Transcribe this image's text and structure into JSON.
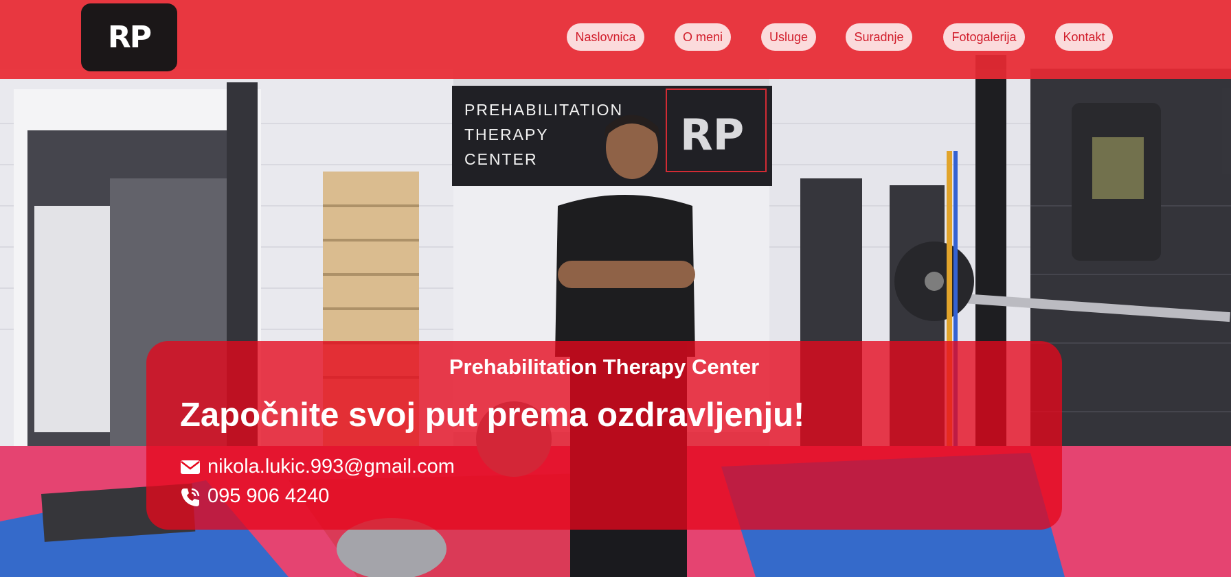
{
  "brand": {
    "logo_text": "RP"
  },
  "nav": {
    "items": [
      {
        "label": "Naslovnica"
      },
      {
        "label": "O meni"
      },
      {
        "label": "Usluge"
      },
      {
        "label": "Suradnje"
      },
      {
        "label": "Fotogalerija"
      },
      {
        "label": "Kontakt"
      }
    ]
  },
  "hero": {
    "sign_lines": [
      "PREHABILITATION",
      "THERAPY",
      "CENTER"
    ],
    "subtitle": "Prehabilitation Therapy Center",
    "headline": "Započnite svoj put prema ozdravljenju!",
    "contact": {
      "email": "nikola.lukic.993@gmail.com",
      "phone": "095 906 4240",
      "email_icon": "envelope-icon",
      "phone_icon": "phone-icon"
    }
  },
  "colors": {
    "header_bg": "#e82a34",
    "panel_bg": "#e6081c",
    "nav_text": "#d11c2a",
    "text": "#ffffff"
  }
}
